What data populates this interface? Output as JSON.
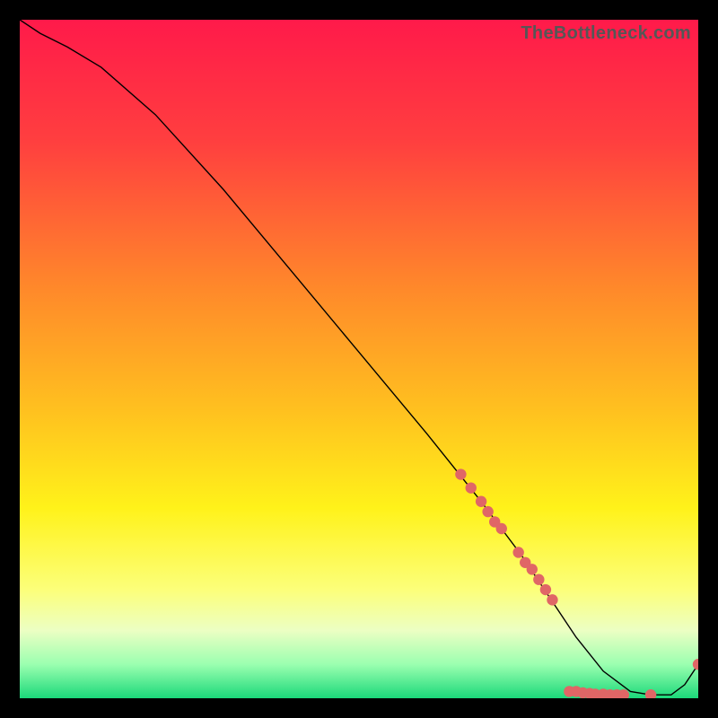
{
  "watermark": "TheBottleneck.com",
  "gradient": {
    "stops": [
      {
        "pct": 0,
        "color": "#ff1a4a"
      },
      {
        "pct": 18,
        "color": "#ff3f3f"
      },
      {
        "pct": 40,
        "color": "#ff8a2a"
      },
      {
        "pct": 58,
        "color": "#ffc21f"
      },
      {
        "pct": 72,
        "color": "#fff21a"
      },
      {
        "pct": 84,
        "color": "#fcff7a"
      },
      {
        "pct": 90,
        "color": "#ecffc3"
      },
      {
        "pct": 95,
        "color": "#9bffb0"
      },
      {
        "pct": 100,
        "color": "#1bd97a"
      }
    ]
  },
  "chart_data": {
    "type": "line",
    "title": "",
    "xlabel": "",
    "ylabel": "",
    "xlim": [
      0,
      100
    ],
    "ylim": [
      0,
      100
    ],
    "grid": false,
    "legend": false,
    "series": [
      {
        "name": "bottleneck-curve",
        "color": "#000000",
        "stroke_width": 1.4,
        "x": [
          0,
          3,
          7,
          12,
          20,
          30,
          40,
          50,
          60,
          68,
          74,
          78,
          82,
          86,
          90,
          93,
          96,
          98,
          100
        ],
        "values": [
          100,
          98,
          96,
          93,
          86,
          75,
          63,
          51,
          39,
          29,
          21,
          15,
          9,
          4,
          1,
          0.5,
          0.5,
          2,
          5
        ]
      }
    ],
    "markers": {
      "name": "highlight-points",
      "color": "#e06666",
      "radius": 6.2,
      "points": [
        {
          "x": 65.0,
          "y": 33.0
        },
        {
          "x": 66.5,
          "y": 31.0
        },
        {
          "x": 68.0,
          "y": 29.0
        },
        {
          "x": 69.0,
          "y": 27.5
        },
        {
          "x": 70.0,
          "y": 26.0
        },
        {
          "x": 71.0,
          "y": 25.0
        },
        {
          "x": 73.5,
          "y": 21.5
        },
        {
          "x": 74.5,
          "y": 20.0
        },
        {
          "x": 75.5,
          "y": 19.0
        },
        {
          "x": 76.5,
          "y": 17.5
        },
        {
          "x": 77.5,
          "y": 16.0
        },
        {
          "x": 78.5,
          "y": 14.5
        },
        {
          "x": 81.0,
          "y": 1.0
        },
        {
          "x": 82.0,
          "y": 1.0
        },
        {
          "x": 83.0,
          "y": 0.8
        },
        {
          "x": 84.0,
          "y": 0.7
        },
        {
          "x": 84.8,
          "y": 0.6
        },
        {
          "x": 86.0,
          "y": 0.6
        },
        {
          "x": 87.0,
          "y": 0.5
        },
        {
          "x": 88.0,
          "y": 0.5
        },
        {
          "x": 89.0,
          "y": 0.5
        },
        {
          "x": 93.0,
          "y": 0.5
        },
        {
          "x": 100.0,
          "y": 5.0
        }
      ]
    }
  }
}
